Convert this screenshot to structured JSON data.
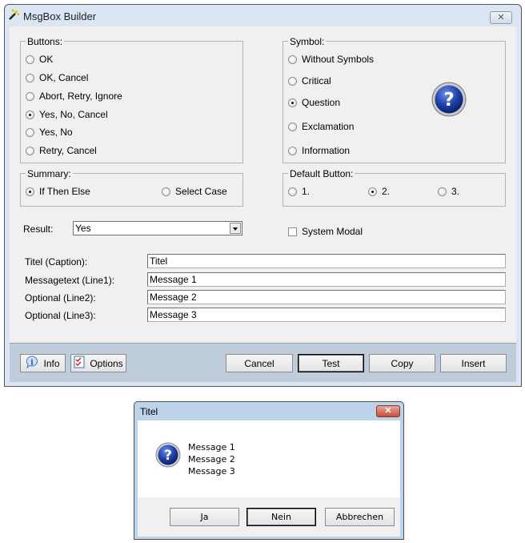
{
  "window": {
    "title": "MsgBox Builder",
    "close_glyph": "✕"
  },
  "buttons_group": {
    "label": "Buttons:",
    "options": [
      "OK",
      "OK, Cancel",
      "Abort, Retry, Ignore",
      "Yes, No, Cancel",
      "Yes, No",
      "Retry, Cancel"
    ],
    "selected": "Yes, No, Cancel"
  },
  "symbol_group": {
    "label": "Symbol:",
    "options": [
      "Without Symbols",
      "Critical",
      "Question",
      "Exclamation",
      "Information"
    ],
    "selected": "Question",
    "preview_icon": "question-icon",
    "preview_glyph": "?"
  },
  "summary_group": {
    "label": "Summary:",
    "options": [
      "If Then Else",
      "Select Case"
    ],
    "selected": "If Then Else"
  },
  "default_button_group": {
    "label": "Default Button:",
    "options": [
      "1.",
      "2.",
      "3."
    ],
    "selected": "2."
  },
  "result": {
    "label": "Result:",
    "value": "Yes"
  },
  "system_modal": {
    "label": "System Modal",
    "checked": false
  },
  "fields": [
    {
      "label": "Titel (Caption):",
      "value": "Titel"
    },
    {
      "label": "Messagetext (Line1):",
      "value": "Message 1"
    },
    {
      "label": "Optional (Line2):",
      "value": "Message 2"
    },
    {
      "label": "Optional (Line3):",
      "value": "Message 3"
    }
  ],
  "footer": {
    "info_label": "Info",
    "options_label": "Options",
    "cancel_label": "Cancel",
    "test_label": "Test",
    "copy_label": "Copy",
    "insert_label": "Insert"
  },
  "preview_dialog": {
    "title": "Titel",
    "close_glyph": "✕",
    "icon_glyph": "?",
    "lines": [
      "Message 1",
      "Message 2",
      "Message 3"
    ],
    "buttons": [
      "Ja",
      "Nein",
      "Abbrechen"
    ],
    "default_button": "Nein"
  },
  "colors": {
    "window_frame": "#dae6f3",
    "client_bg": "#f0f0f0",
    "footer_bg": "#bfcdda",
    "question_icon": "#1f3fa8"
  }
}
